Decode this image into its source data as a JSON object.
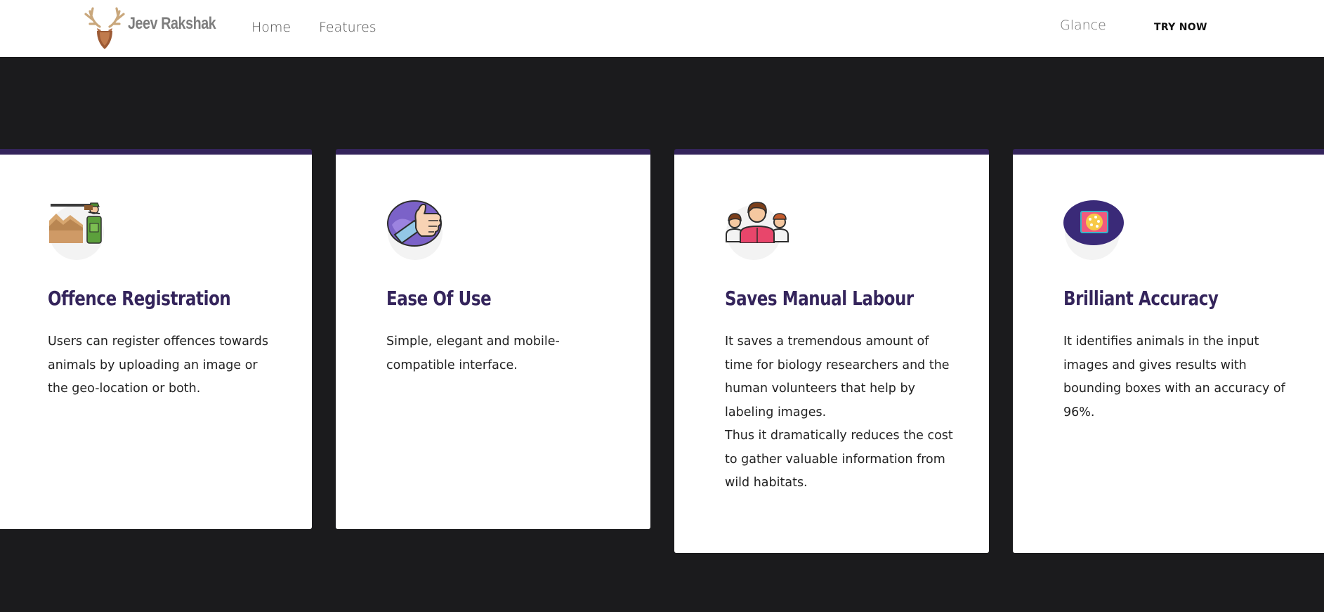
{
  "header": {
    "brand": "Jeev Rakshak",
    "logo_icon": "deer-antler-shield-icon",
    "nav": [
      {
        "label": "Home"
      },
      {
        "label": "Features"
      }
    ],
    "glance_label": "Glance",
    "try_now_label": "TRY NOW"
  },
  "colors": {
    "accent": "#34245b",
    "background": "#1b1b1d",
    "card": "#ffffff"
  },
  "features": [
    {
      "icon": "hunter-rifle-icon",
      "title": "Offence Registration",
      "paragraphs": [
        "Users can register offences towards animals by uploading an image or the geo-location or both."
      ]
    },
    {
      "icon": "thumbs-up-icon",
      "title": "Ease Of Use",
      "paragraphs": [
        "Simple, elegant and mobile-compatible interface."
      ]
    },
    {
      "icon": "people-group-icon",
      "title": "Saves Manual Labour",
      "paragraphs": [
        "It saves a tremendous amount of time for biology researchers and the human volunteers that help by labeling images.",
        "Thus it dramatically reduces the cost to gather valuable information from wild habitats."
      ]
    },
    {
      "icon": "image-target-icon",
      "title": "Brilliant Accuracy",
      "paragraphs": [
        "It identifies animals in the input images and gives results with bounding boxes with an accuracy of 96%."
      ]
    }
  ]
}
